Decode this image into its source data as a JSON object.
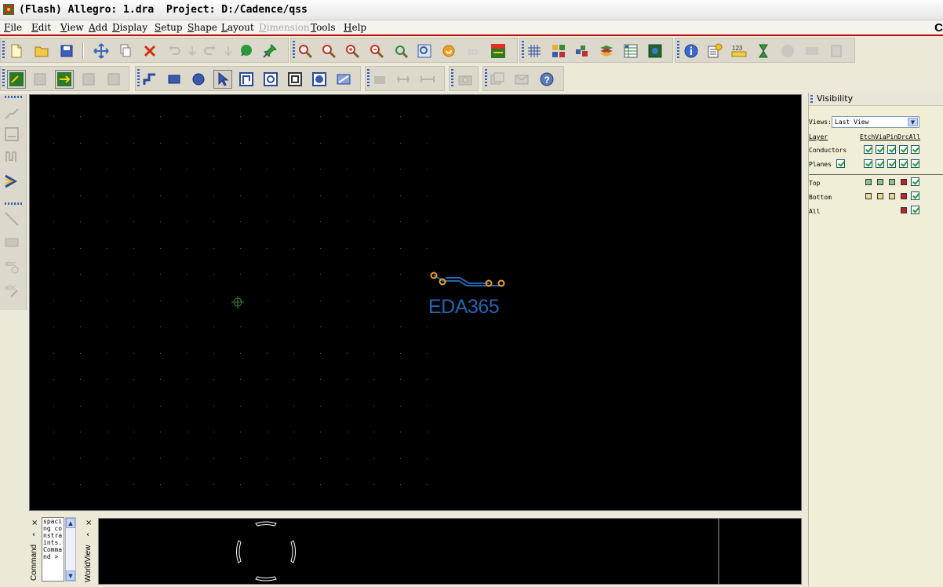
{
  "titlebar": {
    "title": "(Flash) Allegro: 1.dra  Project: D:/Cadence/qss"
  },
  "menu": [
    {
      "key": "F",
      "rest": "ile"
    },
    {
      "key": "E",
      "rest": "dit"
    },
    {
      "key": "V",
      "rest": "iew"
    },
    {
      "key": "A",
      "rest": "dd"
    },
    {
      "key": "D",
      "rest": "isplay"
    },
    {
      "key": "S",
      "rest": "etup"
    },
    {
      "key": "S",
      "rest": "hape"
    },
    {
      "key": "L",
      "rest": "ayout"
    },
    {
      "key": "D",
      "rest": "imension"
    },
    {
      "key": "T",
      "rest": "ools"
    },
    {
      "key": "H",
      "rest": "elp"
    }
  ],
  "menu_clipped": "C",
  "canvas": {
    "watermark": "EDA365",
    "background": "#000000",
    "grid_color": "#5a5a5a"
  },
  "visibility": {
    "title": "Visibility",
    "views_label": "Views:",
    "views_value": "Last View",
    "layer_header": "Layer",
    "columns_header": "EtchViaPinDrcAll",
    "rows": {
      "conductors": "Conductors",
      "planes": "Planes"
    },
    "layers": {
      "top": "Top",
      "bottom": "Bottom",
      "all": "All"
    },
    "swatch_colors": {
      "top_green": "#8fbf8f",
      "bottom_yellow": "#e8d890",
      "red": "#c02030"
    }
  },
  "command": {
    "tab_label": "Command",
    "text": "spacing constraints.Command >"
  },
  "worldview": {
    "tab_label": "WorldView"
  },
  "icons": {
    "close": "×",
    "pin": "‹",
    "up": "▲",
    "down": "▼"
  }
}
